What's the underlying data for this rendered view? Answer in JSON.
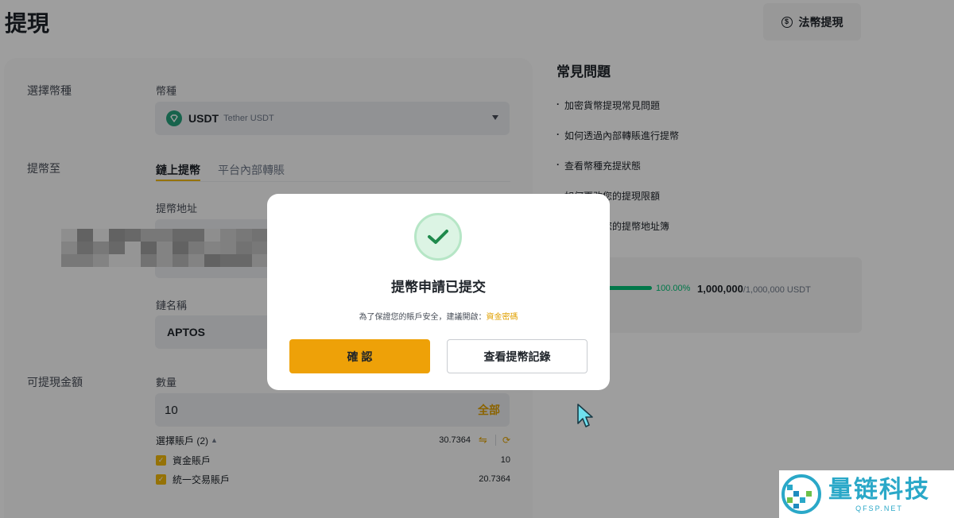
{
  "page": {
    "title": "提現",
    "fiat_button": "法幣提現",
    "fiat_icon": "coin-circle-icon"
  },
  "form": {
    "select_coin_label": "選擇幣種",
    "coin_field_label": "幣種",
    "coin": {
      "code": "USDT",
      "name": "Tether USDT",
      "icon": "usdt-icon",
      "color": "#26a17b"
    },
    "withdraw_to_label": "提幣至",
    "tabs": [
      {
        "label": "鏈上提幣",
        "active": true
      },
      {
        "label": "平台內部轉賬",
        "active": false
      }
    ],
    "address_label": "提幣地址",
    "chain_label": "鏈名稱",
    "chain_value": "APTOS",
    "available_label": "可提現金額",
    "amount_label": "數量",
    "amount_value": "10",
    "all_button": "全部",
    "accounts_header": "選擇賬戶 (2)",
    "accounts_total": "30.7364",
    "accounts": [
      {
        "name": "資金賬戶",
        "value": "10",
        "checked": true
      },
      {
        "name": "統一交易賬戶",
        "value": "20.7364",
        "checked": true
      }
    ]
  },
  "faq": {
    "title": "常見問題",
    "items": [
      "加密貨幣提現常見問題",
      "如何透過內部轉賬進行提幣",
      "查看幣種充提狀態",
      "如何更改您的提現限額",
      "如何使用您的提幣地址簿"
    ]
  },
  "limit": {
    "percent_text": "100.00%",
    "progress": 1.0,
    "used": "1,000,000",
    "total": "/1,000,000 USDT"
  },
  "modal": {
    "title": "提幣申請已提交",
    "note_prefix": "為了保證您的賬戶安全，建議開啟：",
    "note_link": "資金密碼",
    "confirm_button": "確 認",
    "history_button": "查看提幣記錄",
    "icon": "check-circle-icon"
  },
  "watermark": {
    "main": "量链科技",
    "sub": "QFSP.NET"
  },
  "colors": {
    "accent": "#f0b90b",
    "button": "#eea108",
    "success": "#02c076",
    "link": "#e0a000"
  }
}
